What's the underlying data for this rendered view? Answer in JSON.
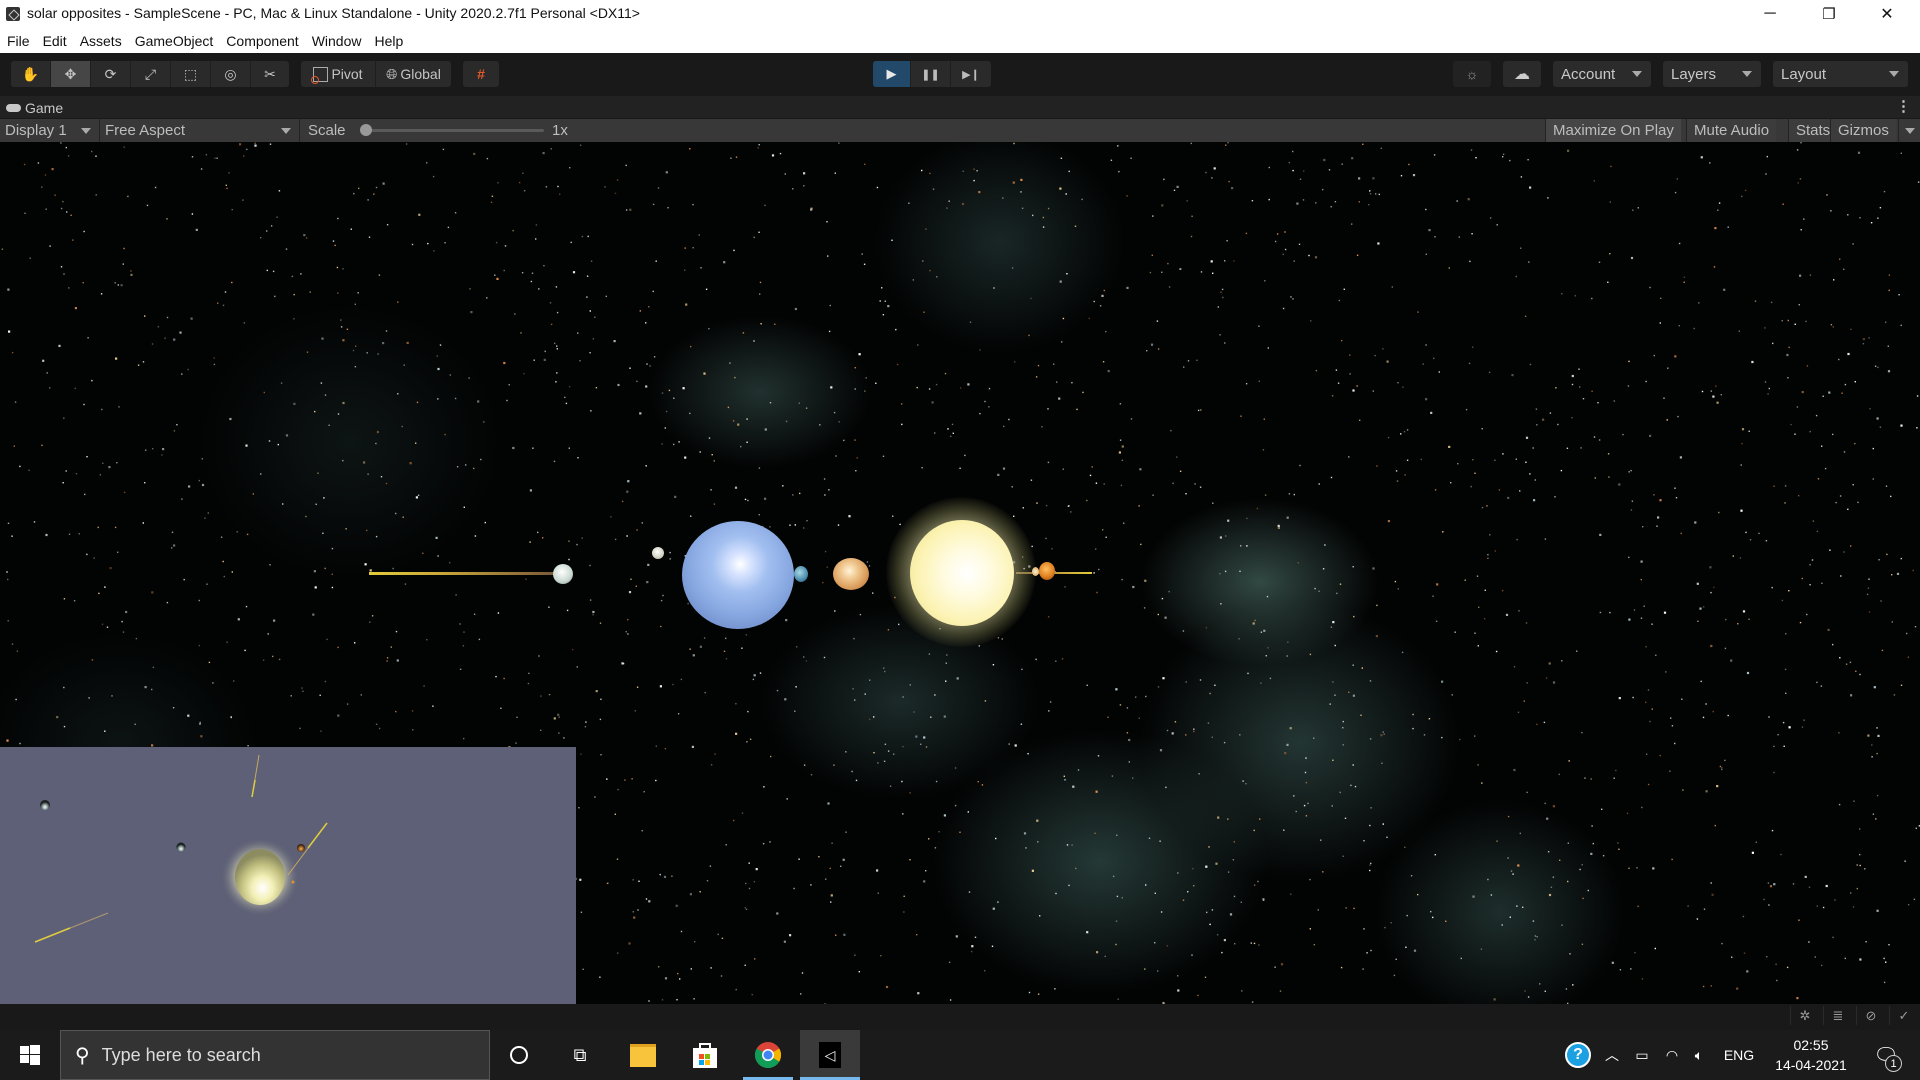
{
  "window": {
    "title": "solar opposites - SampleScene - PC, Mac & Linux Standalone - Unity 2020.2.7f1 Personal <DX11>",
    "controls": {
      "minimize": "─",
      "restore": "❐",
      "close": "✕"
    }
  },
  "menu": [
    "File",
    "Edit",
    "Assets",
    "GameObject",
    "Component",
    "Window",
    "Help"
  ],
  "toolbar": {
    "tools": [
      {
        "name": "hand-tool",
        "icon": "✋"
      },
      {
        "name": "move-tool",
        "icon": "✥",
        "active": true
      },
      {
        "name": "rotate-tool",
        "icon": "⟳"
      },
      {
        "name": "scale-tool",
        "icon": "⤢"
      },
      {
        "name": "rect-tool",
        "icon": "⬚"
      },
      {
        "name": "transform-tool",
        "icon": "◎"
      },
      {
        "name": "custom-tool",
        "icon": "✂"
      }
    ],
    "pivot_label": "Pivot",
    "global_label": "Global",
    "snap_icon": "#",
    "play": {
      "play": "▶",
      "pause": "❚❚",
      "step": "▶❙"
    },
    "play_active_color": "#22486a",
    "account_label": "Account",
    "layers_label": "Layers",
    "layout_label": "Layout"
  },
  "game_panel": {
    "tab_label": "Game",
    "menu_icon": "⋮",
    "display": "Display 1",
    "aspect": "Free Aspect",
    "scale_label": "Scale",
    "scale_value": "1x",
    "scale_slider_fraction": 0,
    "toggles": {
      "maximize_on_play": "Maximize On Play",
      "mute_audio": "Mute Audio",
      "stats": "Stats",
      "gizmos": "Gizmos"
    }
  },
  "scene": {
    "background_color": "#020303",
    "nebula_color": "#4f7a74",
    "trail_color": "#d9c23a",
    "bodies": [
      {
        "name": "sun",
        "color": "#fffbd0"
      },
      {
        "name": "neptune",
        "color": "#8eb0e8"
      },
      {
        "name": "jupiter",
        "color": "#e5b27a"
      },
      {
        "name": "earth",
        "color": "#5c9cc0"
      },
      {
        "name": "moon-white",
        "color": "#e8f0ec"
      },
      {
        "name": "small-moon",
        "color": "#d8d8c8"
      },
      {
        "name": "mars",
        "color": "#e0861e"
      },
      {
        "name": "mercury",
        "color": "#f3dca8"
      }
    ]
  },
  "minimap": {
    "background_color": "#5d6076"
  },
  "statusbar": {
    "icons": [
      "bug-off-icon",
      "database-off-icon",
      "network-off-icon",
      "check-circle-icon"
    ]
  },
  "taskbar": {
    "search_placeholder": "Type here to search",
    "apps": [
      "cortana",
      "task-view",
      "file-explorer",
      "microsoft-store",
      "chrome",
      "unity"
    ],
    "language": "ENG",
    "time": "02:55",
    "date": "14-04-2021",
    "notification_count": "1"
  }
}
